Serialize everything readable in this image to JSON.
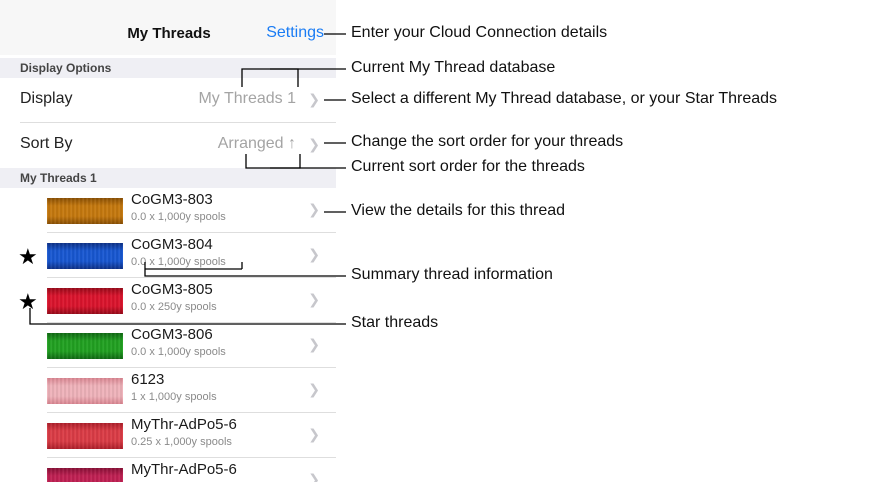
{
  "navbar": {
    "title": "My Threads",
    "settings_label": "Settings"
  },
  "display_options": {
    "header": "Display Options",
    "display_label": "Display",
    "display_value": "My Threads 1",
    "sort_label": "Sort By",
    "sort_value": "Arranged ↑"
  },
  "threads_section": {
    "header": "My Threads 1",
    "items": [
      {
        "name": "CoGM3-803",
        "info": "0.0 x 1,000y spools",
        "star": false,
        "color": "#c9790a",
        "color_dark": "#8c4f00"
      },
      {
        "name": "CoGM3-804",
        "info": "0.0 x 1,000y spools",
        "star": true,
        "color": "#1456d6",
        "color_dark": "#0a2f8a"
      },
      {
        "name": "CoGM3-805",
        "info": "0.0 x 250y spools",
        "star": true,
        "color": "#e0102a",
        "color_dark": "#9a0616"
      },
      {
        "name": "CoGM3-806",
        "info": "0.0 x 1,000y spools",
        "star": false,
        "color": "#1ea31e",
        "color_dark": "#0c6a10"
      },
      {
        "name": "6123",
        "info": "1 x 1,000y spools",
        "star": false,
        "color": "#f5b6be",
        "color_dark": "#e08894"
      },
      {
        "name": "MyThr-AdPo5-6",
        "info": "0.25 x 1,000y spools",
        "star": false,
        "color": "#e03a44",
        "color_dark": "#b21c28"
      },
      {
        "name": "MyThr-AdPo5-6",
        "info": "",
        "star": false,
        "color": "#c41d52",
        "color_dark": "#8a0c34"
      }
    ]
  },
  "callouts": {
    "cloud": "Enter your Cloud Connection details",
    "current_db": "Current My Thread database",
    "select_db": "Select a different My Thread database, or your Star Threads",
    "change_sort": "Change the sort order for your threads",
    "current_sort": "Current sort order for the threads",
    "view_details": "View the details for this thread",
    "summary": "Summary thread information",
    "star": "Star threads"
  },
  "icons": {
    "chevron": "chevron-right-icon",
    "star": "star-icon"
  },
  "colors": {
    "accent": "#1a7cf4",
    "section_bg": "#efeff4",
    "nav_bg": "#f7f7f7"
  }
}
